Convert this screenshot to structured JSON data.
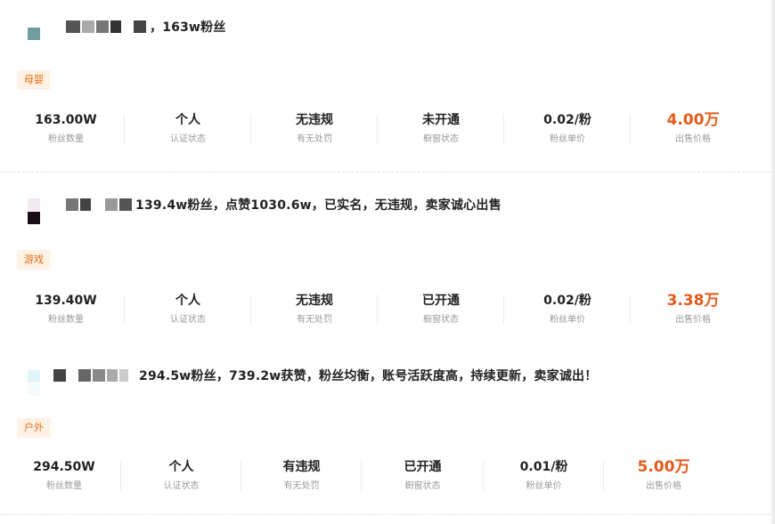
{
  "listings": [
    {
      "title": "，163w粉丝",
      "tag": "母婴",
      "stats": [
        {
          "value": "163.00W",
          "label": "粉丝数量"
        },
        {
          "value": "个人",
          "label": "认证状态"
        },
        {
          "value": "无违规",
          "label": "有无处罚"
        },
        {
          "value": "未开通",
          "label": "橱窗状态"
        },
        {
          "value": "0.02/粉",
          "label": "粉丝单价"
        },
        {
          "value": "4.00万",
          "label": "出售价格"
        }
      ]
    },
    {
      "title": "139.4w粉丝，点赞1030.6w，已实名，无违规，卖家诚心出售",
      "tag": "游戏",
      "stats": [
        {
          "value": "139.40W",
          "label": "粉丝数量"
        },
        {
          "value": "个人",
          "label": "认证状态"
        },
        {
          "value": "无违规",
          "label": "有无处罚"
        },
        {
          "value": "已开通",
          "label": "橱窗状态"
        },
        {
          "value": "0.02/粉",
          "label": "粉丝单价"
        },
        {
          "value": "3.38万",
          "label": "出售价格"
        }
      ]
    },
    {
      "title": "294.5w粉丝，739.2w获赞，粉丝均衡，账号活跃度高，持续更新，卖家诚出！",
      "tag": "户外",
      "stats": [
        {
          "value": "294.50W",
          "label": "粉丝数量"
        },
        {
          "value": "个人",
          "label": "认证状态"
        },
        {
          "value": "有违规",
          "label": "有无处罚"
        },
        {
          "value": "已开通",
          "label": "橱窗状态"
        },
        {
          "value": "0.01/粉",
          "label": "粉丝单价"
        },
        {
          "value": "5.00万",
          "label": "出售价格"
        }
      ]
    }
  ],
  "colors": {
    "accent": "#e45a1a",
    "tag_text": "#e36d18",
    "tag_bg": "#fff1e3"
  }
}
